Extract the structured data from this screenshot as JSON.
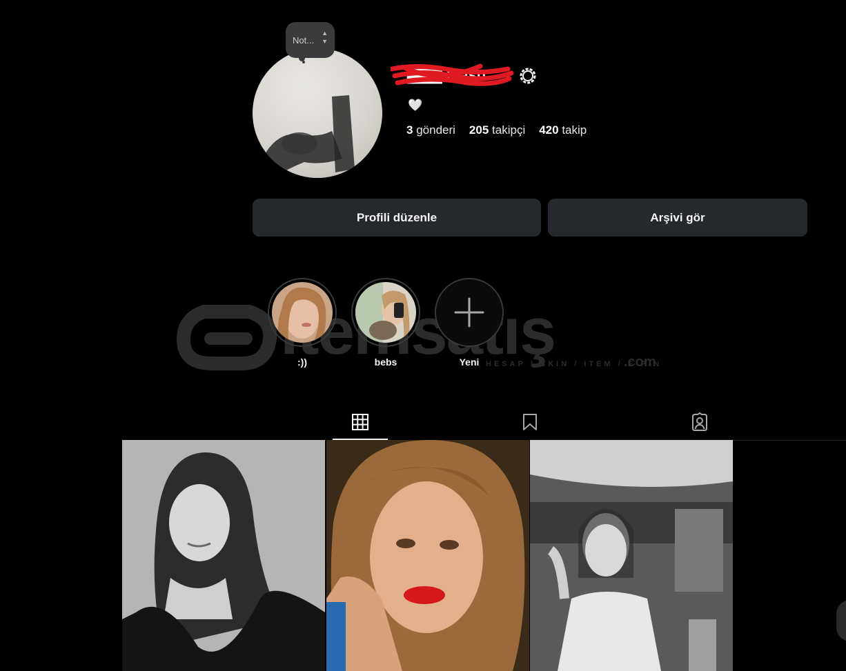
{
  "profile": {
    "note_text": "Not...",
    "username": "▇▇▇ masu",
    "bio": "🤍",
    "stats": {
      "posts_count": "3",
      "posts_label": "gönderi",
      "followers_count": "205",
      "followers_label": "takipçi",
      "following_count": "420",
      "following_label": "takip"
    }
  },
  "actions": {
    "edit_profile": "Profili düzenle",
    "view_archive": "Arşivi gör"
  },
  "highlights": [
    {
      "label": ":))"
    },
    {
      "label": "bebs"
    },
    {
      "label": "Yeni"
    }
  ],
  "tabs": [
    {
      "icon": "grid-icon"
    },
    {
      "icon": "bookmark-icon"
    },
    {
      "icon": "tagged-icon"
    }
  ],
  "watermark": {
    "brand": "itemsatış",
    "sub": "HESAP / SKIN / ITEM / E-PIN",
    "tld": ".com"
  },
  "colors": {
    "background": "#000000",
    "button": "#25282d",
    "text": "#f5f5f5",
    "scribble": "#e01a22"
  }
}
